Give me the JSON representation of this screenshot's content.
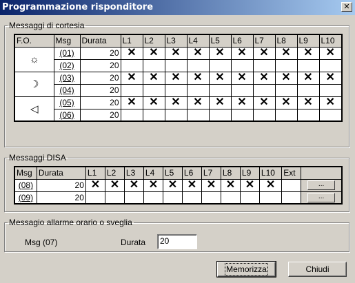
{
  "window": {
    "title": "Programmazione risponditore",
    "close_glyph": "✕"
  },
  "cortesia": {
    "legend": "Messaggi di cortesia",
    "headers": [
      "F.O.",
      "Msg",
      "Durata",
      "L1",
      "L2",
      "L3",
      "L4",
      "L5",
      "L6",
      "L7",
      "L8",
      "L9",
      "L10"
    ],
    "groups": [
      {
        "icon": "sun-icon",
        "glyph": "☼"
      },
      {
        "icon": "moon-icon",
        "glyph": "☽"
      },
      {
        "icon": "speaker-icon",
        "glyph": "◁"
      }
    ],
    "rows": [
      {
        "msg": "(01)",
        "durata": "20",
        "marks": [
          "✕",
          "✕",
          "✕",
          "✕",
          "✕",
          "✕",
          "✕",
          "✕",
          "✕",
          "✕"
        ]
      },
      {
        "msg": "(02)",
        "durata": "20",
        "marks": [
          "",
          "",
          "",
          "",
          "",
          "",
          "",
          "",
          "",
          ""
        ]
      },
      {
        "msg": "(03)",
        "durata": "20",
        "marks": [
          "✕",
          "✕",
          "✕",
          "✕",
          "✕",
          "✕",
          "✕",
          "✕",
          "✕",
          "✕"
        ]
      },
      {
        "msg": "(04)",
        "durata": "20",
        "marks": [
          "",
          "",
          "",
          "",
          "",
          "",
          "",
          "",
          "",
          ""
        ]
      },
      {
        "msg": "(05)",
        "durata": "20",
        "marks": [
          "✕",
          "✕",
          "✕",
          "✕",
          "✕",
          "✕",
          "✕",
          "✕",
          "✕",
          "✕"
        ]
      },
      {
        "msg": "(06)",
        "durata": "20",
        "marks": [
          "",
          "",
          "",
          "",
          "",
          "",
          "",
          "",
          "",
          ""
        ]
      }
    ]
  },
  "disa": {
    "legend": "Messaggi DISA",
    "headers": [
      "Msg",
      "Durata",
      "L1",
      "L2",
      "L3",
      "L4",
      "L5",
      "L6",
      "L7",
      "L8",
      "L9",
      "L10",
      "Ext",
      ""
    ],
    "rows": [
      {
        "msg": "(08)",
        "durata": "20",
        "marks": [
          "✕",
          "✕",
          "✕",
          "✕",
          "✕",
          "✕",
          "✕",
          "✕",
          "✕",
          "✕"
        ],
        "ext": "",
        "button": "..."
      },
      {
        "msg": "(09)",
        "durata": "20",
        "marks": [
          "",
          "",
          "",
          "",
          "",
          "",
          "",
          "",
          "",
          ""
        ],
        "ext": "",
        "button": "..."
      }
    ]
  },
  "allarme": {
    "legend": "Messagio allarme orario o sveglia",
    "msg_label": "Msg  (07)",
    "durata_label": "Durata",
    "durata_value": "20"
  },
  "buttons": {
    "save": "Memorizza",
    "close": "Chiudi"
  }
}
